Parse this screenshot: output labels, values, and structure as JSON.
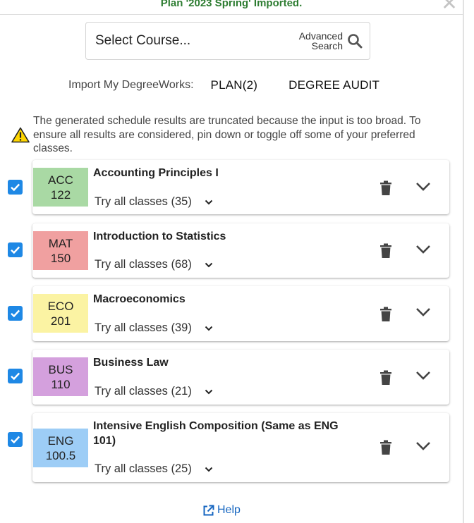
{
  "banner": {
    "message": "Plan '2023 Spring' Imported."
  },
  "search": {
    "placeholder": "Select Course...",
    "advanced_line1": "Advanced",
    "advanced_line2": "Search"
  },
  "import": {
    "label": "Import My DegreeWorks:",
    "plan_button": "PLAN(2)",
    "audit_button": "DEGREE AUDIT"
  },
  "warning": {
    "text": "The generated schedule results are truncated because the input is too broad. To ensure all results are considered, pin down or toggle off some of your preferred classes."
  },
  "courses": [
    {
      "subject": "ACC",
      "number": "122",
      "title": "Accounting Principles I",
      "classes": "Try all classes (35)",
      "color": "#a9d9a4",
      "checked": true
    },
    {
      "subject": "MAT",
      "number": "150",
      "title": "Introduction to Statistics",
      "classes": "Try all classes (68)",
      "color": "#f0a0a0",
      "checked": true
    },
    {
      "subject": "ECO",
      "number": "201",
      "title": "Macroeconomics",
      "classes": "Try all classes (39)",
      "color": "#fbf3a3",
      "checked": true
    },
    {
      "subject": "BUS",
      "number": "110",
      "title": "Business Law",
      "classes": "Try all classes (21)",
      "color": "#d4a0dd",
      "checked": true
    },
    {
      "subject": "ENG",
      "number": "100.5",
      "title": "Intensive English Composition (Same as ENG 101)",
      "classes": "Try all classes (25)",
      "color": "#9dcdf6",
      "checked": true
    }
  ],
  "help": {
    "label": "Help"
  },
  "colors": {
    "accent": "#1e88e5",
    "success": "#2e7d32",
    "link": "#1565c0",
    "warning": "#ffd600"
  },
  "icons": {
    "close": "close-icon",
    "search": "search-icon",
    "warning": "warning-icon",
    "check": "check-icon",
    "trash": "trash-icon",
    "expand": "chevron-down-icon",
    "external": "external-link-icon"
  }
}
